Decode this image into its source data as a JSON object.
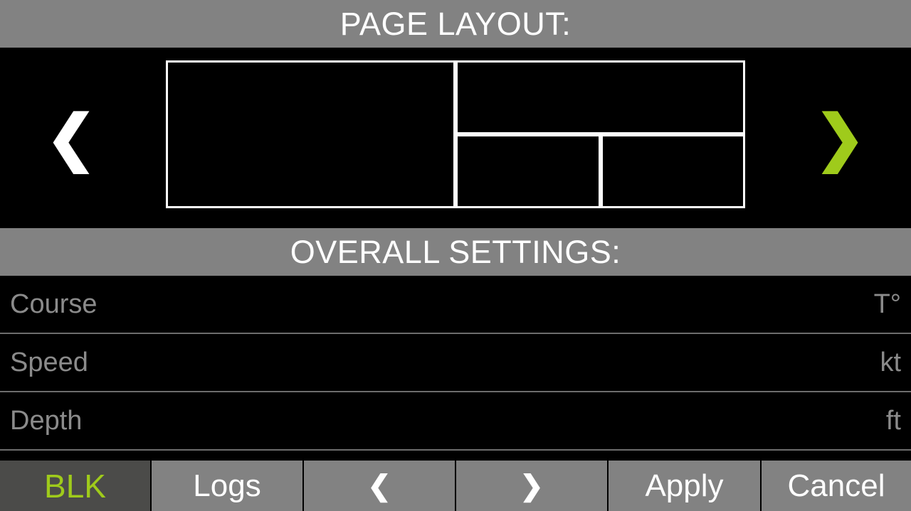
{
  "colors": {
    "background": "#000000",
    "header_bar": "#828282",
    "accent_green": "#9fcb1b",
    "active_button": "#4b4b49",
    "label_gray": "#8b8b8b",
    "divider": "#6d6d6d",
    "pane_border": "#ffffff"
  },
  "page_layout": {
    "header_title": "PAGE LAYOUT:",
    "prev_arrow": "❮",
    "next_arrow": "❯",
    "panes": [
      {
        "name": "main"
      },
      {
        "name": "top-right"
      },
      {
        "name": "bottom-left"
      },
      {
        "name": "bottom-right"
      }
    ]
  },
  "overall_settings": {
    "header_title": "OVERALL SETTINGS:",
    "rows": [
      {
        "label": "Course",
        "unit": "T°"
      },
      {
        "label": "Speed",
        "unit": "kt"
      },
      {
        "label": "Depth",
        "unit": "ft"
      }
    ]
  },
  "toolbar": {
    "blk_label": "BLK",
    "logs_label": "Logs",
    "prev_label": "❮",
    "next_label": "❯",
    "apply_label": "Apply",
    "cancel_label": "Cancel"
  }
}
